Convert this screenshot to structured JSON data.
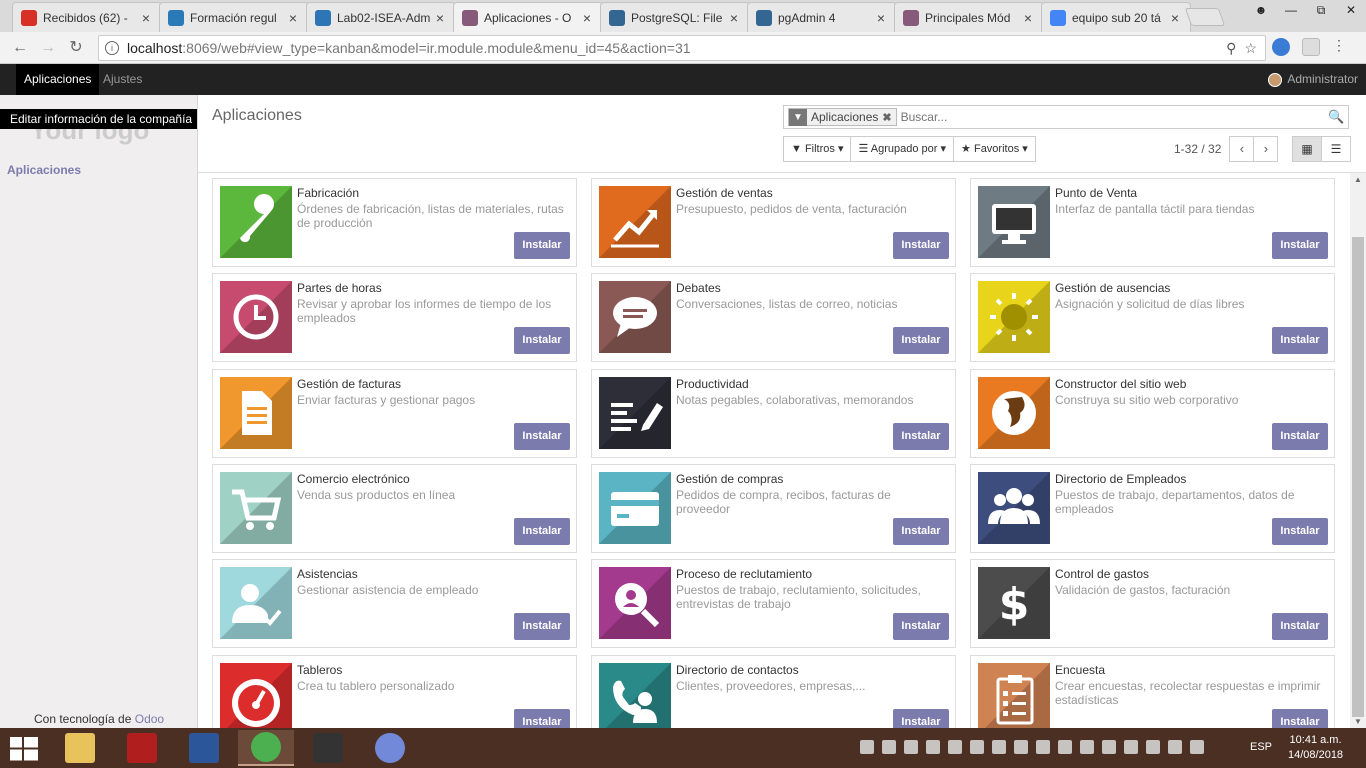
{
  "browser": {
    "tabs": [
      {
        "title": "Recibidos (62) -",
        "icon": "gmail-icon",
        "color": "#d93025"
      },
      {
        "title": "Formación regul",
        "icon": "site-icon",
        "color": "#2a7ab8"
      },
      {
        "title": "Lab02-ISEA-Adm",
        "icon": "vs-icon",
        "color": "#2e75b6"
      },
      {
        "title": "Aplicaciones - O",
        "icon": "odoo-icon",
        "color": "#875a7b"
      },
      {
        "title": "PostgreSQL: File",
        "icon": "postgres-icon",
        "color": "#336791"
      },
      {
        "title": "pgAdmin 4",
        "icon": "pgadmin-icon",
        "color": "#336791"
      },
      {
        "title": "Principales Mód",
        "icon": "odoo-icon",
        "color": "#875a7b"
      },
      {
        "title": "equipo sub 20 tá",
        "icon": "google-icon",
        "color": "#4285f4"
      }
    ],
    "url_host": "localhost",
    "url_path": ":8069/web#view_type=kanban&model=ir.module.module&menu_id=45&action=31"
  },
  "odoo_nav": {
    "menu": [
      "Aplicaciones",
      "Ajustes"
    ],
    "user": "Administrator"
  },
  "sidebar": {
    "logo_text": "Your logo",
    "tooltip": "Editar información de la compañía",
    "link": "Aplicaciones",
    "powered_prefix": "Con tecnología de",
    "powered_brand": "Odoo"
  },
  "control": {
    "breadcrumb": "Aplicaciones",
    "facet": "Aplicaciones",
    "search_placeholder": "Buscar...",
    "filters": "Filtros",
    "group_by": "Agrupado por",
    "favorites": "Favoritos",
    "pager": "1-32 / 32"
  },
  "install_label": "Instalar",
  "apps": [
    {
      "name": "Fabricación",
      "desc": "Órdenes de fabricación, listas de materiales, rutas de producción",
      "color": "#5cb83c",
      "icon": "wrench-icon"
    },
    {
      "name": "Gestión de ventas",
      "desc": "Presupuesto, pedidos de venta, facturación",
      "color": "#e06a1e",
      "icon": "trend-chart-icon"
    },
    {
      "name": "Punto de Venta",
      "desc": "Interfaz de pantalla táctil para tiendas",
      "color": "#6f7b82",
      "icon": "monitor-icon"
    },
    {
      "name": "Partes de horas",
      "desc": "Revisar y aprobar los informes de tiempo de los empleados",
      "color": "#c64b6e",
      "icon": "clock-icon"
    },
    {
      "name": "Debates",
      "desc": "Conversaciones, listas de correo, noticias",
      "color": "#8a5955",
      "icon": "chat-icon"
    },
    {
      "name": "Gestión de ausencias",
      "desc": "Asignación y solicitud de días libres",
      "color": "#e8d41a",
      "icon": "sun-icon"
    },
    {
      "name": "Gestión de facturas",
      "desc": "Enviar facturas y gestionar pagos",
      "color": "#f0982d",
      "icon": "document-icon"
    },
    {
      "name": "Productividad",
      "desc": "Notas pegables, colaborativas, memorandos",
      "color": "#2e2e38",
      "icon": "pencil-icon"
    },
    {
      "name": "Constructor del sitio web",
      "desc": "Construya su sitio web corporativo",
      "color": "#ea7a22",
      "icon": "globe-icon"
    },
    {
      "name": "Comercio electrónico",
      "desc": "Venda sus productos en línea",
      "color": "#9fd1c5",
      "icon": "cart-icon"
    },
    {
      "name": "Gestión de compras",
      "desc": "Pedidos de compra, recibos, facturas de proveedor",
      "color": "#5ab4c3",
      "icon": "credit-card-icon"
    },
    {
      "name": "Directorio de Empleados",
      "desc": "Puestos de trabajo, departamentos, datos de empleados",
      "color": "#3d4e7e",
      "icon": "users-icon"
    },
    {
      "name": "Asistencias",
      "desc": "Gestionar asistencia de empleado",
      "color": "#9fd9de",
      "icon": "user-check-icon"
    },
    {
      "name": "Proceso de reclutamiento",
      "desc": "Puestos de trabajo, reclutamiento, solicitudes, entrevistas de trabajo",
      "color": "#a43a8d",
      "icon": "search-user-icon"
    },
    {
      "name": "Control de gastos",
      "desc": "Validación de gastos, facturación",
      "color": "#4c4c4c",
      "icon": "dollar-icon"
    },
    {
      "name": "Tableros",
      "desc": "Crea tu tablero personalizado",
      "color": "#dd2c2c",
      "icon": "gauge-icon"
    },
    {
      "name": "Directorio de contactos",
      "desc": "Clientes, proveedores, empresas,...",
      "color": "#2a8a89",
      "icon": "contact-icon"
    },
    {
      "name": "Encuesta",
      "desc": "Crear encuestas, recolectar respuestas e imprimir estadísticas",
      "color": "#cf8252",
      "icon": "clipboard-icon"
    }
  ],
  "taskbar": {
    "apps": [
      "file-explorer-icon",
      "dota-icon",
      "word-icon",
      "chrome-icon",
      "nox-icon",
      "discord-icon"
    ],
    "lang": "ESP",
    "time": "10:41 a.m.",
    "date": "14/08/2018"
  }
}
